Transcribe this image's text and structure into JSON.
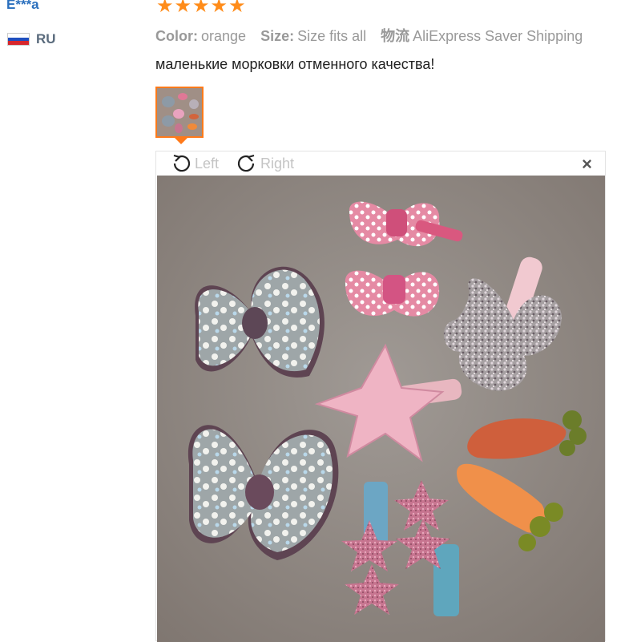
{
  "reviewer": {
    "name": "E***a",
    "country_code": "RU",
    "flag_colors": [
      "#ffffff",
      "#1f4fbf",
      "#d7262c"
    ]
  },
  "rating": {
    "stars": 5,
    "max": 5,
    "color": "#ff8c1a"
  },
  "meta": {
    "color_key": "Color:",
    "color_value": "orange",
    "size_key": "Size:",
    "size_value": "Size fits all",
    "shipping_key": "物流",
    "shipping_value": "AliExpress Saver Shipping"
  },
  "review_text": "маленькие морковки отменного качества!",
  "viewer": {
    "rotate_left_label": "Left",
    "rotate_right_label": "Right",
    "close_label": "×",
    "rotate_left_icon": "rotate-left-icon",
    "rotate_right_icon": "rotate-right-icon"
  },
  "accent_color": "#ff7a1a"
}
